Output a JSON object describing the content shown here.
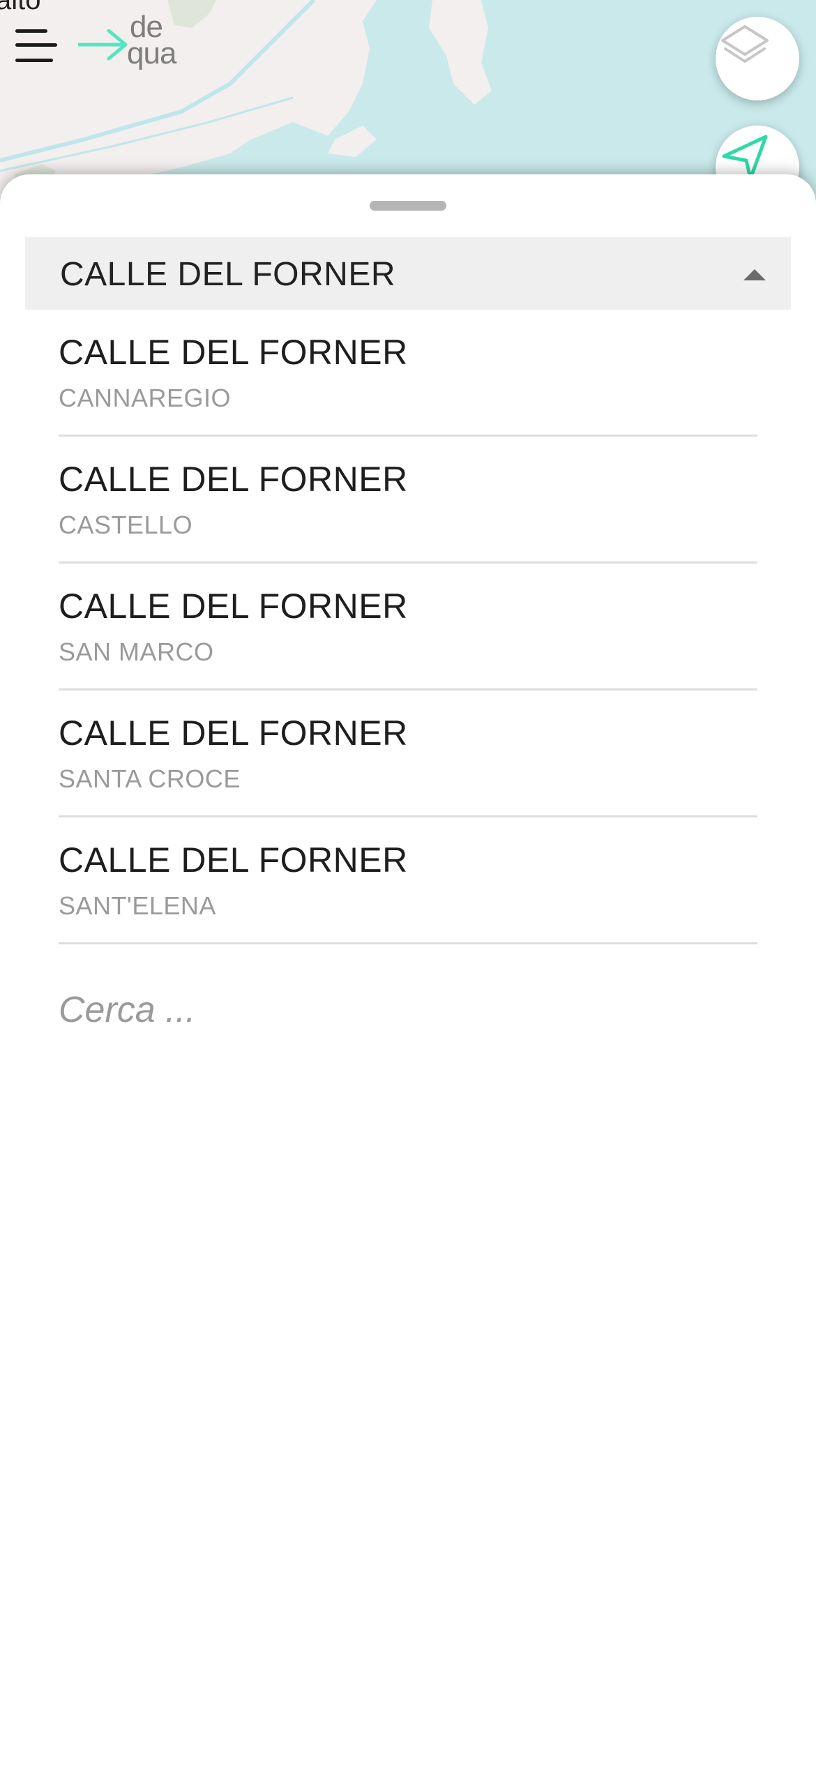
{
  "map": {
    "corner_label": "alto",
    "colors": {
      "land": "#f3efee",
      "water": "#c9e9ea",
      "park": "#dfe6d9"
    }
  },
  "header": {
    "menu_icon": "hamburger-menu-icon",
    "logo": {
      "line1": "de",
      "line2": "qua",
      "arrow_color": "#54e6c1"
    },
    "layers_icon": "layers-icon",
    "locate_icon": "navigation-arrow-icon"
  },
  "sheet": {
    "selected_value": "CALLE DEL FORNER",
    "options": [
      {
        "title": "CALLE DEL FORNER",
        "district": "CANNAREGIO"
      },
      {
        "title": "CALLE DEL FORNER",
        "district": "CASTELLO"
      },
      {
        "title": "CALLE DEL FORNER",
        "district": "SAN MARCO"
      },
      {
        "title": "CALLE DEL FORNER",
        "district": "SANTA CROCE"
      },
      {
        "title": "CALLE DEL FORNER",
        "district": "SANT'ELENA"
      }
    ],
    "search_placeholder": "Cerca",
    "search_value": "..."
  }
}
